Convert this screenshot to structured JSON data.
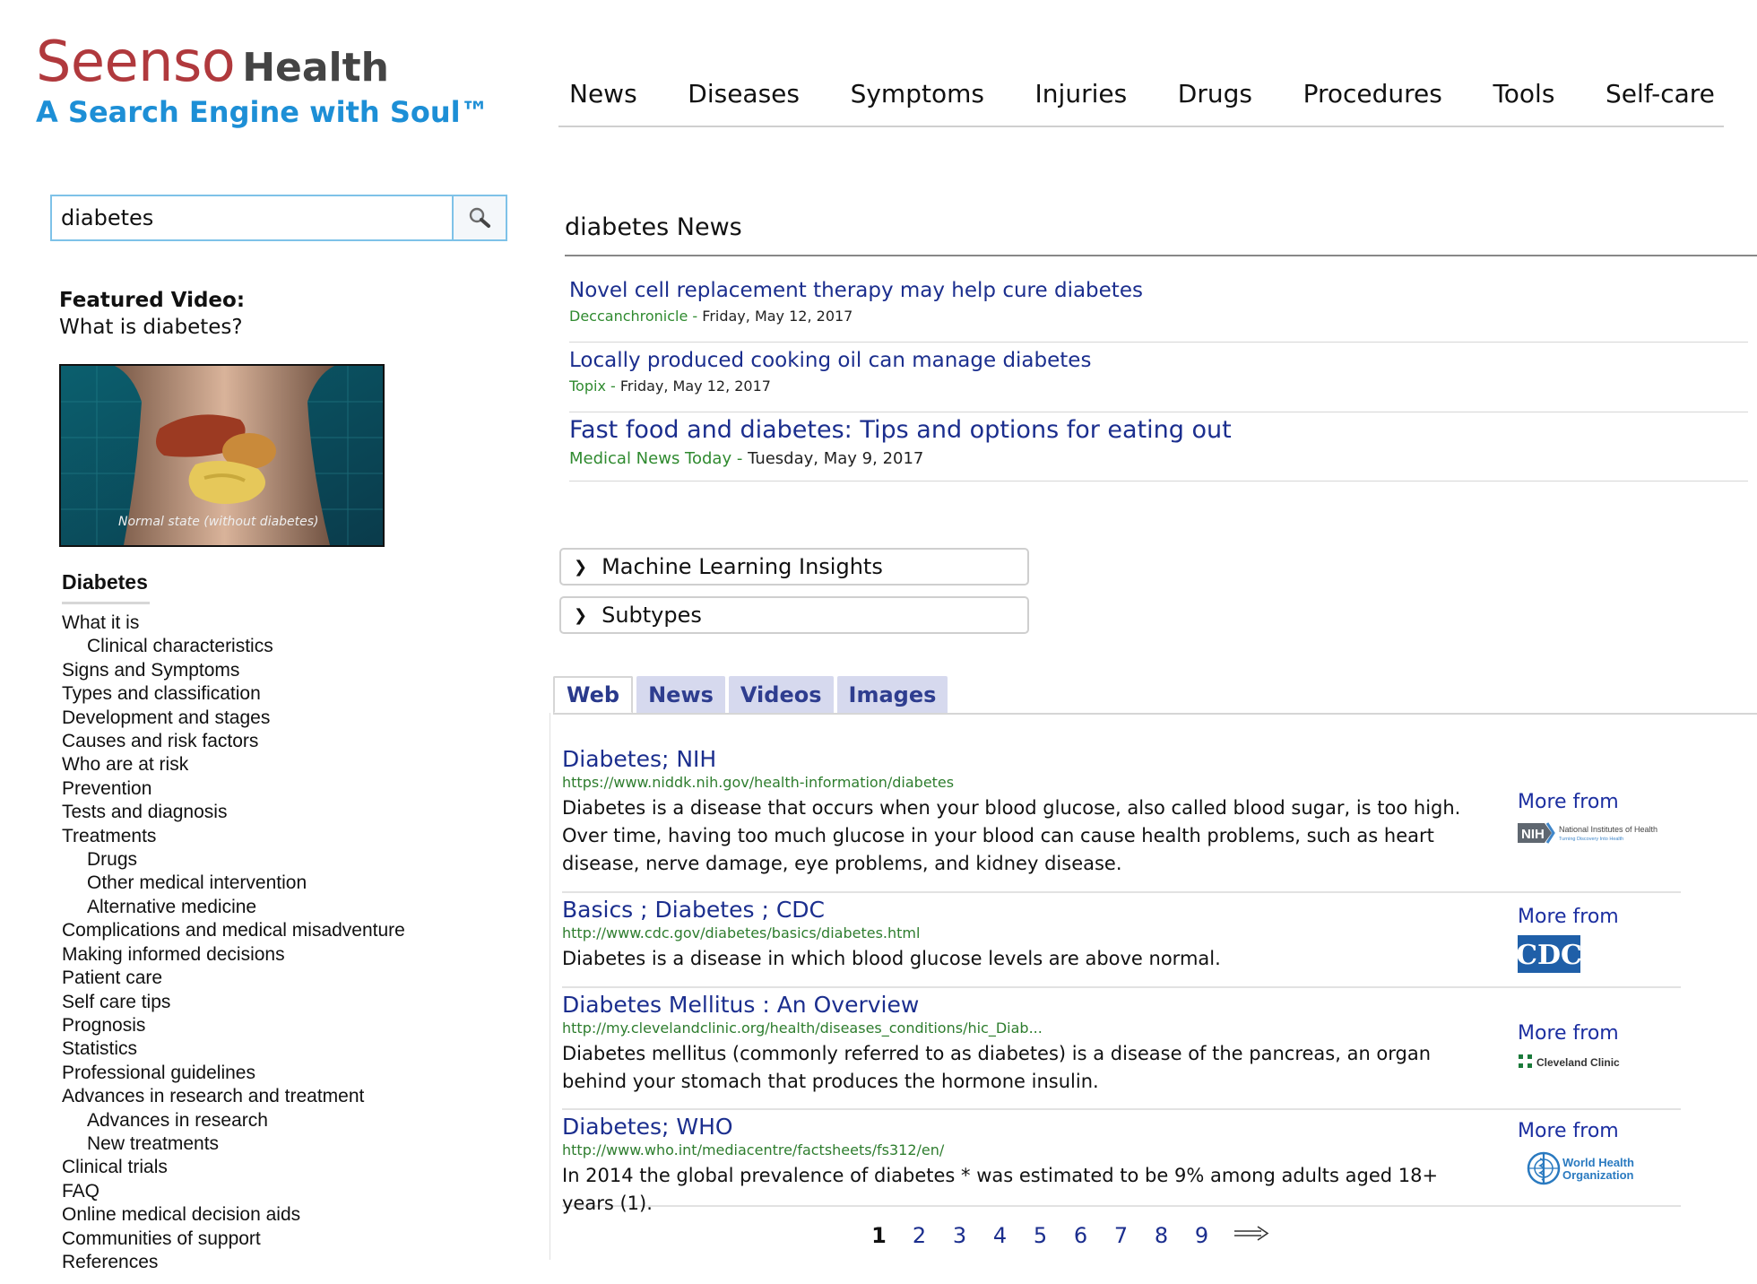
{
  "logo": {
    "brand": "Seenso",
    "brand_suffix": "Health",
    "tagline": "A Search Engine with Soul™"
  },
  "nav": [
    "News",
    "Diseases",
    "Symptoms",
    "Injuries",
    "Drugs",
    "Procedures",
    "Tools",
    "Self-care"
  ],
  "search": {
    "value": "diabetes",
    "icon": "magnifier-icon"
  },
  "featured_video": {
    "label": "Featured Video:",
    "title": "What is diabetes?",
    "caption": "Normal state (without diabetes)"
  },
  "toc": {
    "title": "Diabetes",
    "items": [
      {
        "label": "What it is",
        "sub": false
      },
      {
        "label": "Clinical characteristics",
        "sub": true
      },
      {
        "label": "Signs and Symptoms",
        "sub": false
      },
      {
        "label": "Types and classification",
        "sub": false
      },
      {
        "label": "Development and stages",
        "sub": false
      },
      {
        "label": "Causes and risk factors",
        "sub": false
      },
      {
        "label": "Who are at risk",
        "sub": false
      },
      {
        "label": "Prevention",
        "sub": false
      },
      {
        "label": "Tests and diagnosis",
        "sub": false
      },
      {
        "label": "Treatments",
        "sub": false
      },
      {
        "label": "Drugs",
        "sub": true
      },
      {
        "label": "Other medical intervention",
        "sub": true
      },
      {
        "label": "Alternative medicine",
        "sub": true
      },
      {
        "label": "Complications and medical misadventure",
        "sub": false
      },
      {
        "label": "Making informed decisions",
        "sub": false
      },
      {
        "label": "Patient care",
        "sub": false
      },
      {
        "label": "Self care tips",
        "sub": false
      },
      {
        "label": "Prognosis",
        "sub": false
      },
      {
        "label": "Statistics",
        "sub": false
      },
      {
        "label": "Professional guidelines",
        "sub": false
      },
      {
        "label": "Advances in research and treatment",
        "sub": false
      },
      {
        "label": "Advances in research",
        "sub": true
      },
      {
        "label": "New treatments",
        "sub": true
      },
      {
        "label": "Clinical trials",
        "sub": false
      },
      {
        "label": "FAQ",
        "sub": false
      },
      {
        "label": "Online medical decision aids",
        "sub": false
      },
      {
        "label": "Communities of support",
        "sub": false
      },
      {
        "label": "References",
        "sub": false
      }
    ]
  },
  "news": {
    "heading": "diabetes News",
    "items": [
      {
        "title": "Novel cell replacement therapy may help cure diabetes",
        "source": "Deccanchronicle",
        "date": "Friday, May 12, 2017"
      },
      {
        "title": "Locally produced cooking oil can manage diabetes",
        "source": "Topix",
        "date": "Friday, May 12, 2017"
      },
      {
        "title": "Fast food and diabetes: Tips and options for eating out",
        "source": "Medical News Today",
        "date": "Tuesday, May 9, 2017"
      }
    ],
    "separator": " - "
  },
  "panels": [
    "Machine Learning Insights",
    "Subtypes"
  ],
  "tabs": [
    "Web",
    "News",
    "Videos",
    "Images"
  ],
  "active_tab": "Web",
  "results": [
    {
      "title": "Diabetes; NIH",
      "url": "https://www.niddk.nih.gov/health-information/diabetes",
      "snippet": "Diabetes is a disease that occurs when your blood glucose, also called blood sugar, is too high. Over time, having too much glucose in your blood can cause health problems, such as heart disease, nerve damage, eye problems, and kidney disease.",
      "more_from": "More from",
      "source_logo": {
        "badge": "NIH",
        "text": "National Institutes of Health",
        "subtext": "Turning Discovery Into Health"
      }
    },
    {
      "title": "Basics ; Diabetes ; CDC",
      "url": "http://www.cdc.gov/diabetes/basics/diabetes.html",
      "snippet": "Diabetes is a disease in which blood glucose levels are above normal.",
      "more_from": "More from",
      "source_logo": {
        "badge": "CDC"
      }
    },
    {
      "title": "Diabetes Mellitus : An Overview",
      "url": "http://my.clevelandclinic.org/health/diseases_conditions/hic_Diab...",
      "snippet": "Diabetes mellitus (commonly referred to as diabetes) is a disease of the pancreas, an organ behind your stomach that produces the hormone insulin.",
      "more_from": "More from",
      "source_logo": {
        "text": "Cleveland Clinic"
      }
    },
    {
      "title": "Diabetes; WHO",
      "url": "http://www.who.int/mediacentre/factsheets/fs312/en/",
      "snippet": "In 2014 the global prevalence of diabetes * was estimated to be 9% among adults aged 18+ years (1).",
      "more_from": "More from",
      "source_logo": {
        "line1": "World Health",
        "line2": "Organization"
      }
    }
  ],
  "pagination": {
    "pages": [
      "1",
      "2",
      "3",
      "4",
      "5",
      "6",
      "7",
      "8",
      "9"
    ],
    "current": "1",
    "next_icon": "arrow-right-icon"
  },
  "colors": {
    "brand_red": "#b0393d",
    "tagline_blue": "#1d8fd6",
    "link_navy": "#1b2e8e",
    "url_green": "#2e7d2e",
    "tab_bg": "#d6d9ee",
    "cdc_blue": "#1f5fa8"
  }
}
